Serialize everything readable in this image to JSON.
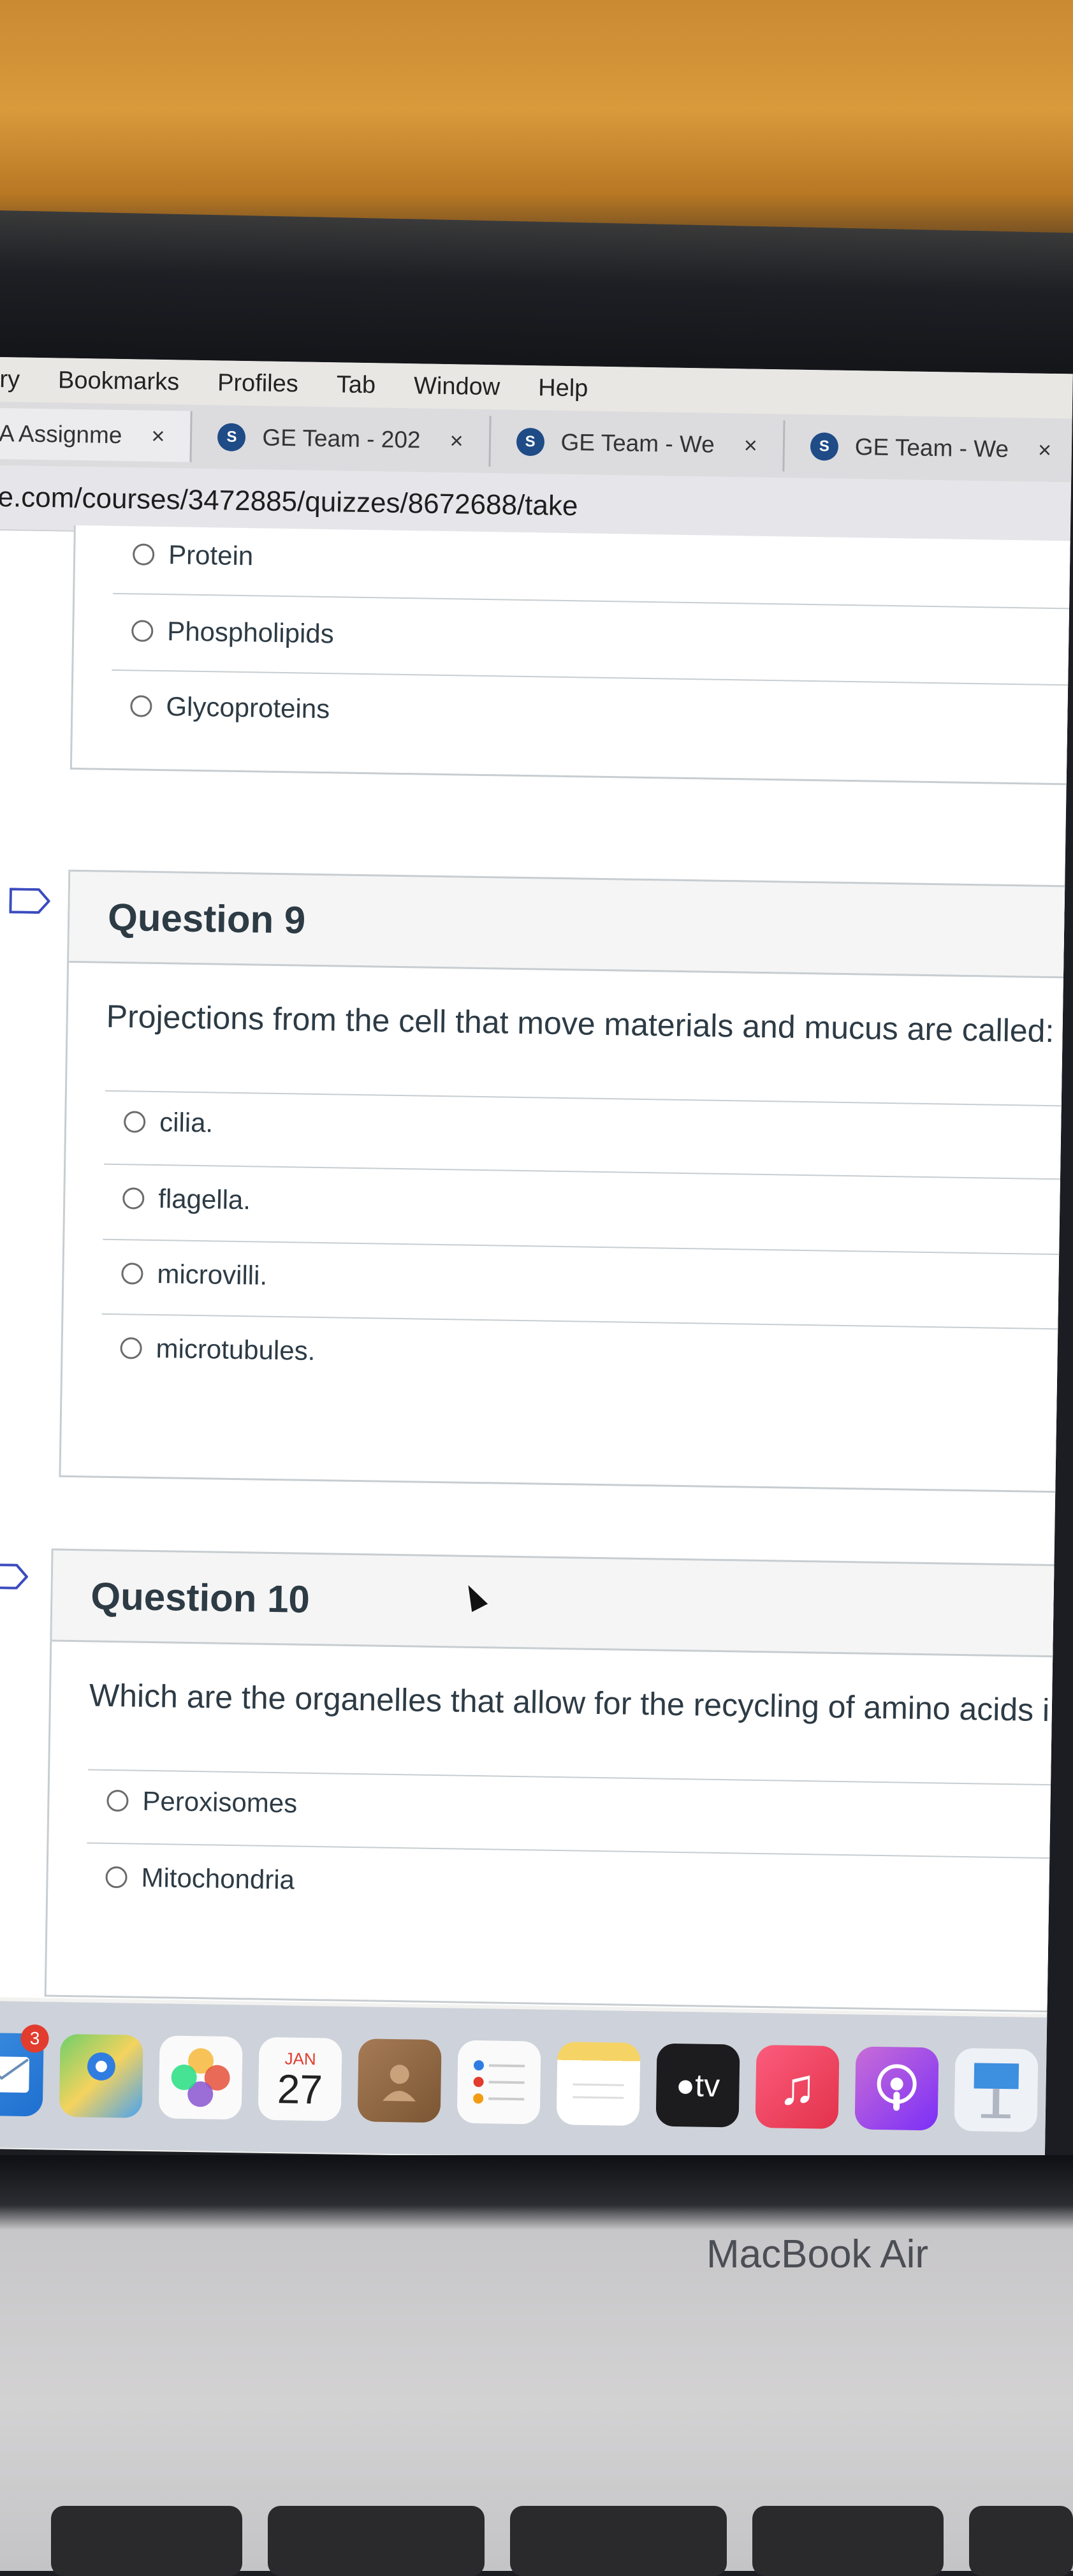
{
  "menubar": [
    "ry",
    "Bookmarks",
    "Profiles",
    "Tab",
    "Window",
    "Help"
  ],
  "tabs": [
    {
      "icon": "",
      "label": "A Assignme",
      "close": "×"
    },
    {
      "icon": "S",
      "label": "GE Team - 202",
      "close": "×"
    },
    {
      "icon": "S",
      "label": "GE Team - We",
      "close": "×"
    },
    {
      "icon": "S",
      "label": "GE Team - We",
      "close": "×"
    }
  ],
  "address": "e.com/courses/3472885/quizzes/8672688/take",
  "prev_question": {
    "answers": [
      "Protein",
      "Phospholipids",
      "Glycoproteins"
    ]
  },
  "question9": {
    "title": "Question 9",
    "text": "Projections from the cell that move materials and mucus are called:",
    "answers": [
      "cilia.",
      "flagella.",
      "microvilli.",
      "microtubules."
    ]
  },
  "question10": {
    "title": "Question 10",
    "text": "Which are the organelles that allow for the recycling of amino acids i",
    "answers": [
      "Peroxisomes",
      "Mitochondria"
    ]
  },
  "dock": {
    "mail_badge": "3",
    "calendar_month": "JAN",
    "calendar_day": "27",
    "tv_label": "tv"
  },
  "device_label": "MacBook Air",
  "colors": {
    "accent_text": "#2d3b45",
    "border": "#c7cdd1",
    "header_bg": "#f5f5f5"
  }
}
